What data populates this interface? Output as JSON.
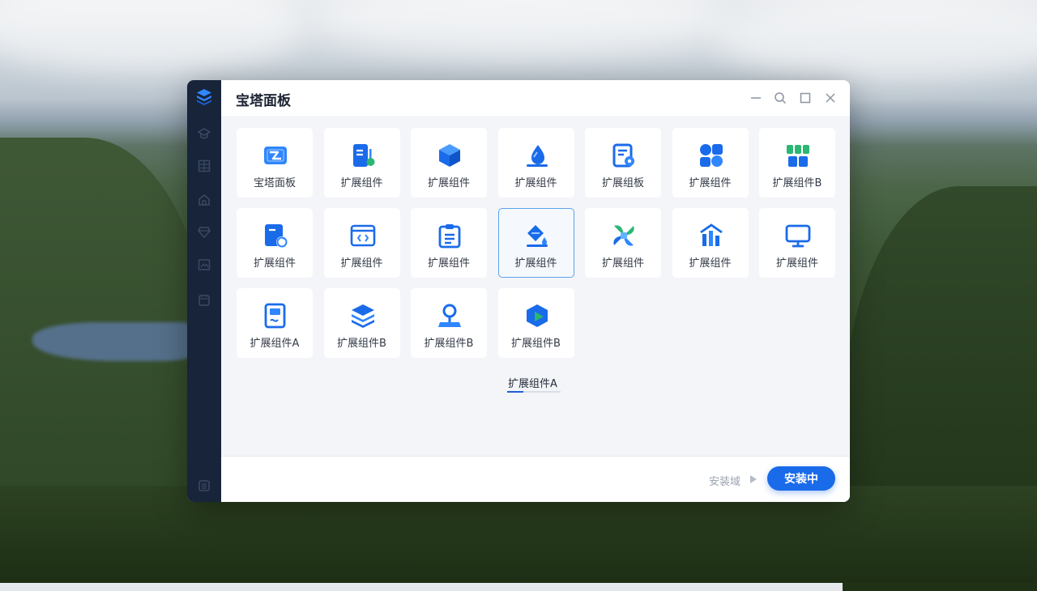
{
  "window": {
    "title": "宝塔面板"
  },
  "tiles": [
    {
      "label": "宝塔面板",
      "icon": "ticket-icon"
    },
    {
      "label": "扩展组件",
      "icon": "server-badge-icon"
    },
    {
      "label": "扩展组件",
      "icon": "cube-icon"
    },
    {
      "label": "扩展组件",
      "icon": "droplet-icon"
    },
    {
      "label": "扩展组板",
      "icon": "document-gear-icon"
    },
    {
      "label": "扩展组件",
      "icon": "shapes-icon"
    },
    {
      "label": "扩展组件B",
      "icon": "blocks-icon"
    },
    {
      "label": "扩展组件",
      "icon": "file-refresh-icon"
    },
    {
      "label": "扩展组件",
      "icon": "browser-code-icon"
    },
    {
      "label": "扩展组件",
      "icon": "clipboard-icon"
    },
    {
      "label": "扩展组件",
      "icon": "paint-bucket-icon",
      "selected": true
    },
    {
      "label": "扩展组件",
      "icon": "petals-icon"
    },
    {
      "label": "扩展组件",
      "icon": "chart-house-icon"
    },
    {
      "label": "扩展组件",
      "icon": "monitor-icon"
    },
    {
      "label": "扩展组件A",
      "icon": "document-edit-icon"
    },
    {
      "label": "扩展组件B",
      "icon": "layers-icon"
    },
    {
      "label": "扩展组件B",
      "icon": "map-pin-icon"
    },
    {
      "label": "扩展组件B",
      "icon": "play-box-icon"
    }
  ],
  "tab": {
    "label": "扩展组件A"
  },
  "footer": {
    "status_text": "安装域",
    "install_button": "安装中"
  },
  "colors": {
    "accent": "#1a6bea",
    "sidebar": "#18243a",
    "green": "#2bb673"
  }
}
